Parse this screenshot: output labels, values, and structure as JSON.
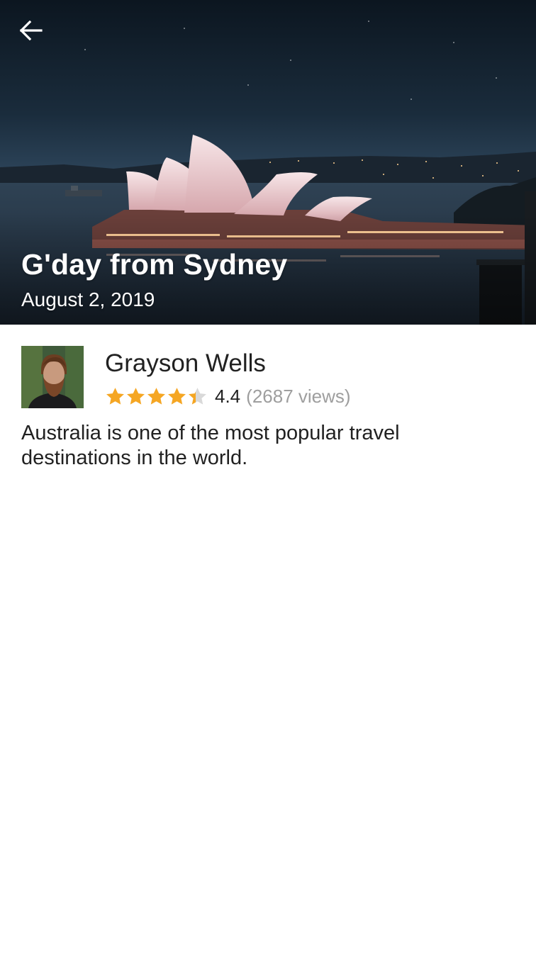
{
  "hero": {
    "title": "G'day from Sydney",
    "date": "August 2, 2019",
    "back_icon": "arrow-left-icon",
    "image": "sydney-opera-house-night"
  },
  "author": {
    "name": "Grayson Wells",
    "avatar": "bearded-man-portrait",
    "rating": 4.4,
    "rating_label": "4.4",
    "views_label": "(2687 views)",
    "stars_max": 5
  },
  "description": "Australia is one of the most popular travel destinations in the world.",
  "colors": {
    "star_filled": "#F5A623",
    "star_empty": "#D9D9D9",
    "text_primary": "#212121",
    "text_secondary": "#9E9E9E",
    "hero_text": "#FFFFFF"
  }
}
